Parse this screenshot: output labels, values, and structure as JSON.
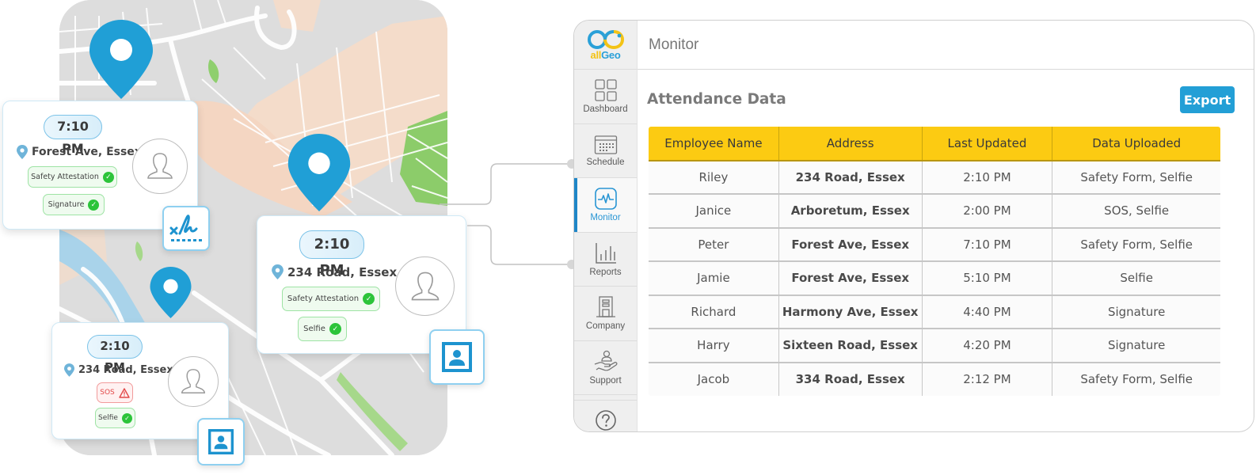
{
  "colors": {
    "brand_blue": "#239fd6",
    "pin_blue": "#209fd6",
    "header_yellow": "#fccb12",
    "check_green": "#2cc43a",
    "sos_red": "#e24848",
    "active_nav": "#1f86c7"
  },
  "map_cards": [
    {
      "time": "7:10 PM",
      "address": "Forest Ave, Essex",
      "chips": [
        {
          "label": "Safety Attestation",
          "status": "check-icon"
        },
        {
          "label": "Signature",
          "status": "check-icon"
        }
      ],
      "badge_icon": "signature-icon"
    },
    {
      "time": "2:10 PM",
      "address": "234 Road, Essex",
      "chips": [
        {
          "label": "Safety Attestation",
          "status": "check-icon"
        },
        {
          "label": "Selfie",
          "status": "check-icon"
        }
      ],
      "badge_icon": "photo-id-icon"
    },
    {
      "time": "2:10 PM",
      "address": "234 Road, Essex",
      "chips": [
        {
          "label": "SOS",
          "status": "warning-icon"
        },
        {
          "label": "Selfie",
          "status": "check-icon"
        }
      ],
      "badge_icon": "photo-id-icon"
    }
  ],
  "app": {
    "logo": {
      "part1": "all",
      "part2": "Geo"
    },
    "header_title": "Monitor",
    "sidebar": [
      {
        "label": "Dashboard",
        "icon": "dashboard-icon",
        "active": false
      },
      {
        "label": "Schedule",
        "icon": "calendar-icon",
        "active": false
      },
      {
        "label": "Monitor",
        "icon": "pulse-monitor-icon",
        "active": true
      },
      {
        "label": "Reports",
        "icon": "bar-chart-icon",
        "active": false
      },
      {
        "label": "Company",
        "icon": "building-icon",
        "active": false
      },
      {
        "label": "Support",
        "icon": "support-hand-icon",
        "active": false
      }
    ],
    "help_icon": "help-icon",
    "section_title": "Attendance Data",
    "export_label": "Export",
    "table": {
      "columns": [
        "Employee Name",
        "Address",
        "Last Updated",
        "Data Uploaded"
      ],
      "rows": [
        [
          "Riley",
          "234 Road, Essex",
          "2:10 PM",
          "Safety Form, Selfie"
        ],
        [
          "Janice",
          "Arboretum, Essex",
          "2:00 PM",
          "SOS, Selfie"
        ],
        [
          "Peter",
          "Forest Ave, Essex",
          "7:10 PM",
          "Safety Form, Selfie"
        ],
        [
          "Jamie",
          "Forest Ave, Essex",
          "5:10 PM",
          "Selfie"
        ],
        [
          "Richard",
          "Harmony Ave, Essex",
          "4:40 PM",
          "Signature"
        ],
        [
          "Harry",
          "Sixteen Road, Essex",
          "4:20 PM",
          "Signature"
        ],
        [
          "Jacob",
          "334 Road, Essex",
          "2:12 PM",
          "Safety Form, Selfie"
        ]
      ]
    }
  }
}
